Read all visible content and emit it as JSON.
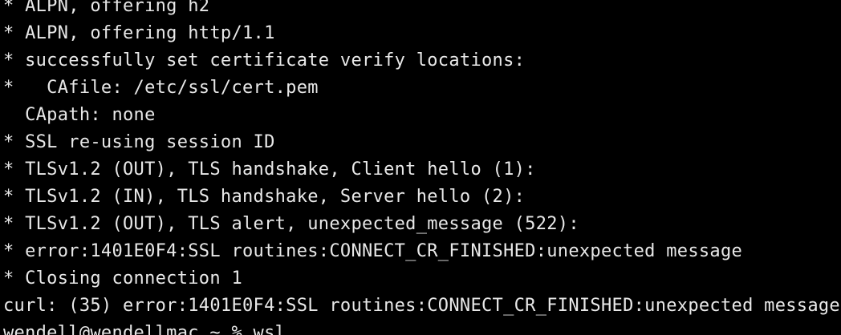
{
  "terminal": {
    "lines": [
      "* ALPN, offering h2",
      "* ALPN, offering http/1.1",
      "* successfully set certificate verify locations:",
      "*   CAfile: /etc/ssl/cert.pem",
      "  CApath: none",
      "* SSL re-using session ID",
      "* TLSv1.2 (OUT), TLS handshake, Client hello (1):",
      "* TLSv1.2 (IN), TLS handshake, Server hello (2):",
      "* TLSv1.2 (OUT), TLS alert, unexpected_message (522):",
      "* error:1401E0F4:SSL routines:CONNECT_CR_FINISHED:unexpected message",
      "* Closing connection 1",
      "curl: (35) error:1401E0F4:SSL routines:CONNECT_CR_FINISHED:unexpected message",
      "wendell@wendellmac ~ % wsl"
    ]
  }
}
